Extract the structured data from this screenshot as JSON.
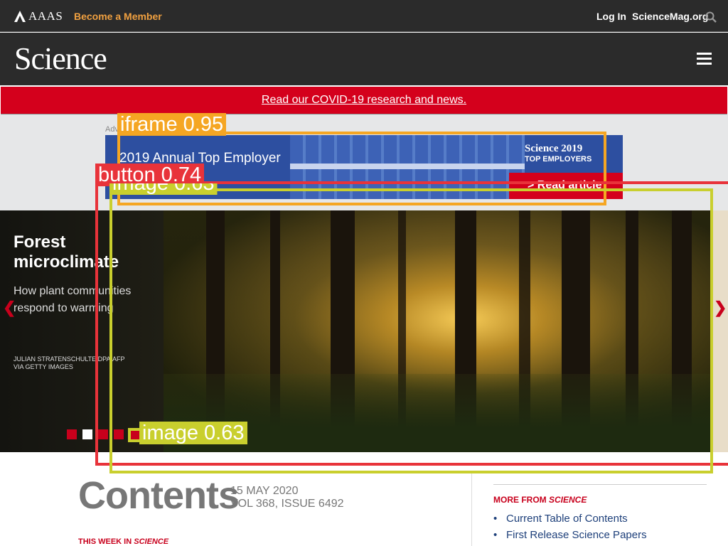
{
  "topbar": {
    "org": "AAAS",
    "member_label": "Become a Member",
    "login_label": "Log In",
    "site_label": "ScienceMag.org"
  },
  "masthead": {
    "logo": "Science"
  },
  "alert": {
    "text": "Read our COVID-19 research and news."
  },
  "ad": {
    "label": "Adv",
    "headline": "2019 Annual Top Employer",
    "subline": "'s #1",
    "brand_line1": "Science 2019",
    "brand_line2": "TOP EMPLOYERS",
    "cta": "> Read article"
  },
  "hero": {
    "title": "Forest microclimate",
    "description": "How plant communities respond to warming",
    "credit": "JULIAN STRATENSCHULTE/DPA/AFP VIA GETTY IMAGES",
    "prev_arrow": "❮",
    "next_arrow": "❯",
    "dots": 5,
    "active_dot": 2
  },
  "contents": {
    "heading": "Contents",
    "date": "15 MAY 2020",
    "volume": "VOL 368, ISSUE 6492",
    "section_prefix": "THIS WEEK IN ",
    "section_name": "SCIENCE"
  },
  "more": {
    "heading_prefix": "MORE FROM ",
    "heading_name": "SCIENCE",
    "links": [
      "Current Table of Contents",
      "First Release Science Papers"
    ]
  },
  "overlays": [
    {
      "label": "iframe 0.95",
      "color": "#f5a623"
    },
    {
      "label": "button 0.74",
      "color": "#e8333a"
    },
    {
      "label": "image 0.63",
      "color": "#c9cf2e"
    },
    {
      "label": "image 0.63",
      "color": "#c9cf2e"
    }
  ]
}
